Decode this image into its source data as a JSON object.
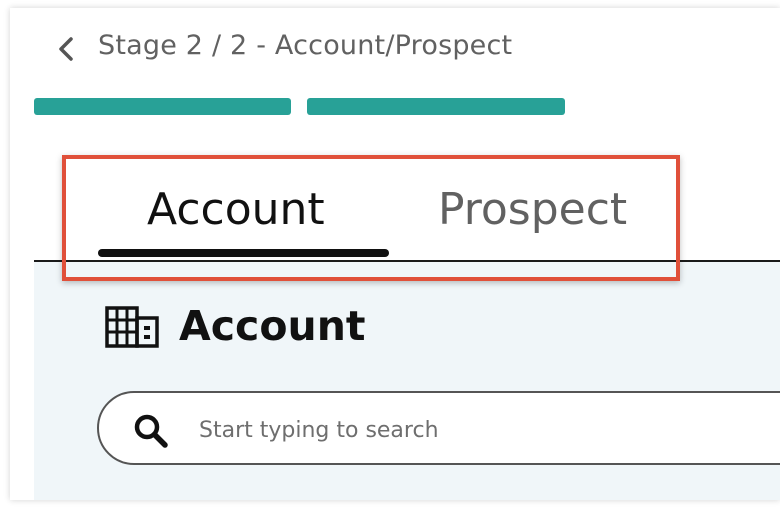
{
  "header": {
    "back_icon": "chevron-left-icon",
    "stage_title": "Stage 2 / 2 - Account/Prospect",
    "progress_segments": [
      {
        "label": "stage-1",
        "complete": true
      },
      {
        "label": "stage-2",
        "complete": true
      }
    ]
  },
  "tabs": [
    {
      "label": "Account",
      "active": true
    },
    {
      "label": "Prospect",
      "active": false
    }
  ],
  "section": {
    "icon": "building-icon",
    "title": "Account"
  },
  "search": {
    "icon": "search-icon",
    "placeholder": "Start typing to search",
    "value": ""
  },
  "colors": {
    "accent_teal": "#28a197",
    "highlight_red": "#e0503a",
    "panel_bg": "#f0f6f9",
    "text_primary": "#111111",
    "text_secondary": "#616161"
  }
}
